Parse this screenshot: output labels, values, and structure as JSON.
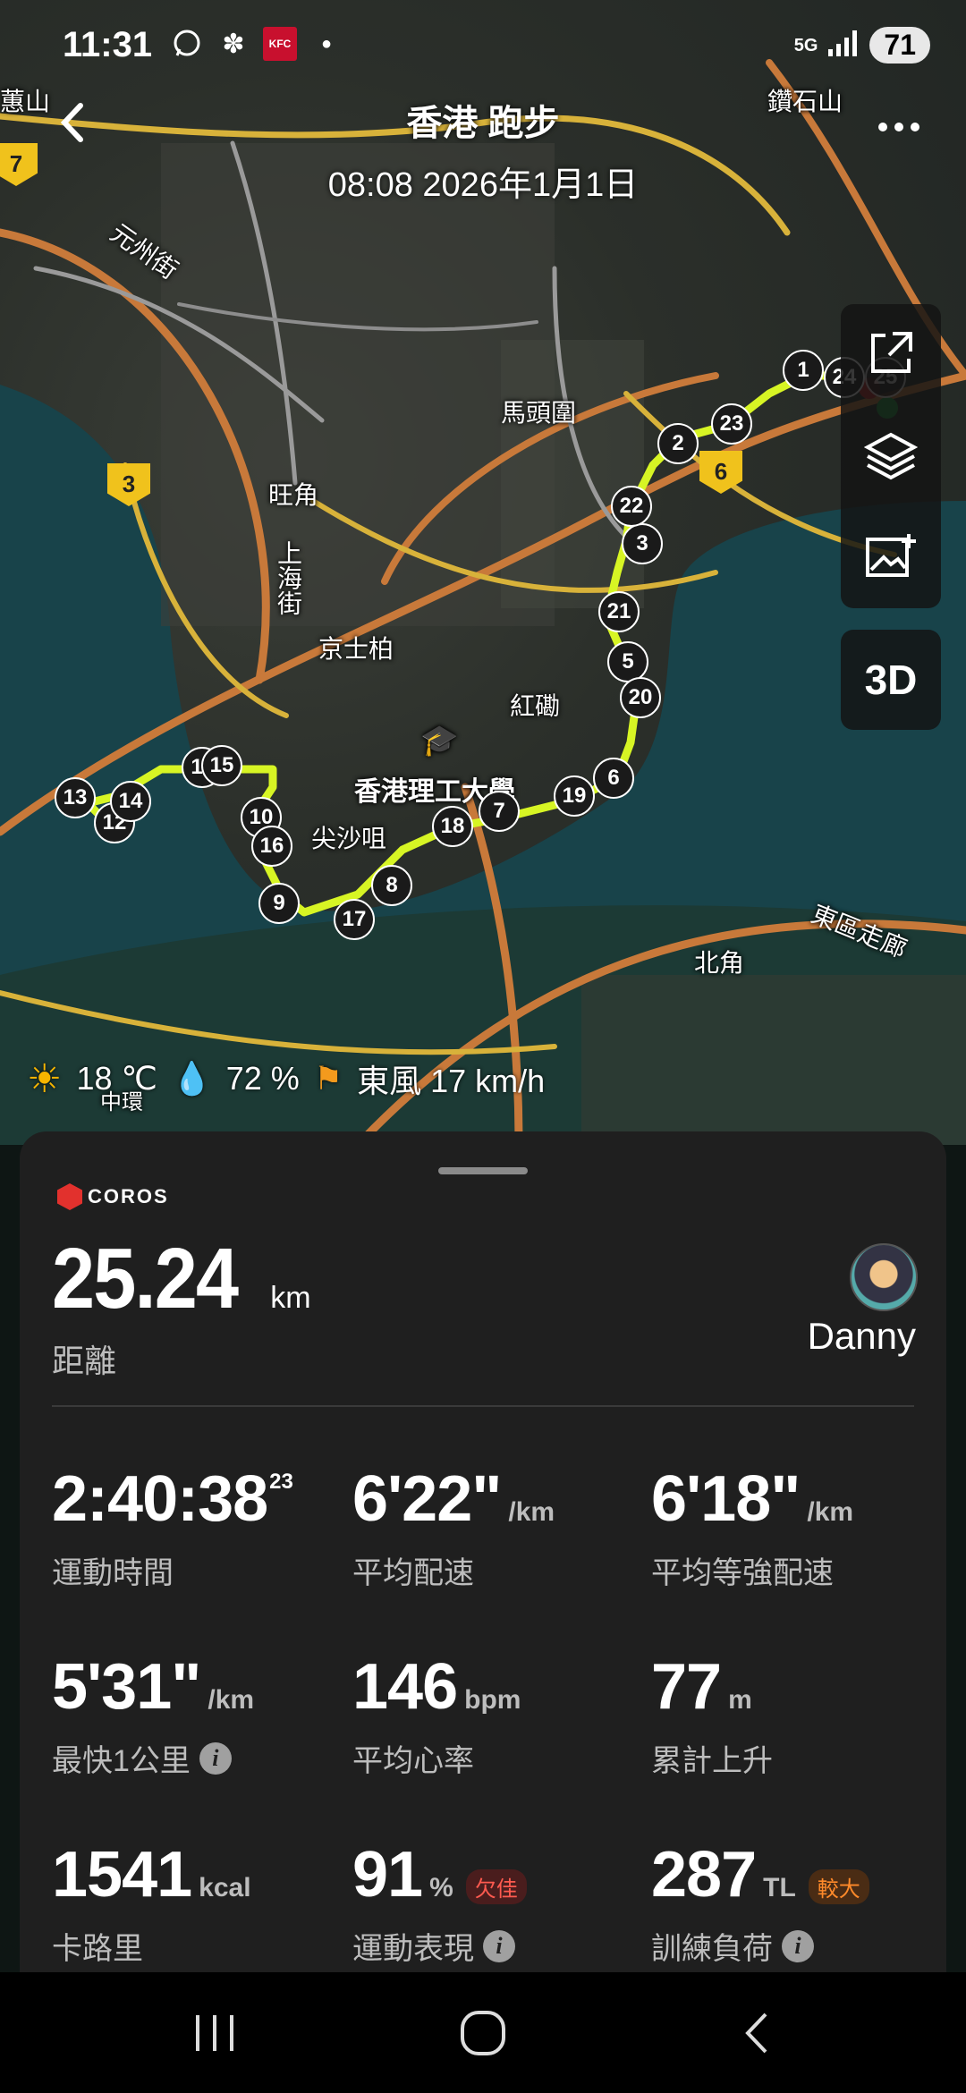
{
  "status_bar": {
    "time": "11:31",
    "icons": [
      "whatsapp-icon",
      "flower-icon",
      "kfc-app-icon",
      "dot-icon"
    ],
    "kfc_text": "KFC",
    "network": "5G",
    "battery": "71"
  },
  "header": {
    "title": "香港 跑步",
    "datetime": "08:08 2026年1月1日"
  },
  "map": {
    "labels": {
      "tsuen_shan": "鑽石山",
      "yuen_chau": "元州街",
      "ma_tau_wai": "馬頭圍",
      "mong_kok": "旺角",
      "shanghai_st": "上海街",
      "king_sze_pak": "京士柏",
      "hung_hom": "紅磡",
      "polyu": "香港理工大學",
      "tst": "尖沙咀",
      "eastern_corridor": "東區走廊",
      "north_point": "北角",
      "central": "中環",
      "left_edge": "蕙山"
    },
    "route_shields": [
      "7",
      "3",
      "6"
    ],
    "kilometer_markers": [
      "1",
      "2",
      "3",
      "5",
      "6",
      "7",
      "8",
      "9",
      "10",
      "11",
      "12",
      "13",
      "14",
      "15",
      "16",
      "17",
      "18",
      "19",
      "20",
      "21",
      "22",
      "23",
      "24",
      "25"
    ],
    "tools": [
      "share-icon",
      "layers-icon",
      "add-photo-icon"
    ],
    "btn_3d": "3D"
  },
  "weather": {
    "temperature": "18 ℃",
    "humidity": "72 %",
    "wind": "東風 17 km/h"
  },
  "summary": {
    "brand": "COROS",
    "distance": "25.24",
    "distance_unit": "km",
    "distance_label": "距離",
    "user_name": "Danny",
    "stats": [
      {
        "value": "2:40:38",
        "sup": "23",
        "unit": "",
        "label": "運動時間"
      },
      {
        "value": "6'22\"",
        "unit": "/km",
        "label": "平均配速"
      },
      {
        "value": "6'18\"",
        "unit": "/km",
        "label": "平均等強配速"
      },
      {
        "value": "5'31\"",
        "unit": "/km",
        "label": "最快1公里",
        "info": true
      },
      {
        "value": "146",
        "unit": "bpm",
        "label": "平均心率"
      },
      {
        "value": "77",
        "unit": "m",
        "label": "累計上升"
      },
      {
        "value": "1541",
        "unit": "kcal",
        "label": "卡路里"
      },
      {
        "value": "91",
        "unit": "%",
        "badge": "欠佳",
        "label": "運動表現",
        "info": true
      },
      {
        "value": "287",
        "unit": "TL",
        "badge": "較大",
        "label": "訓練負荷",
        "info": true
      }
    ]
  },
  "nav": [
    "recent-apps-icon",
    "home-icon",
    "back-icon"
  ]
}
